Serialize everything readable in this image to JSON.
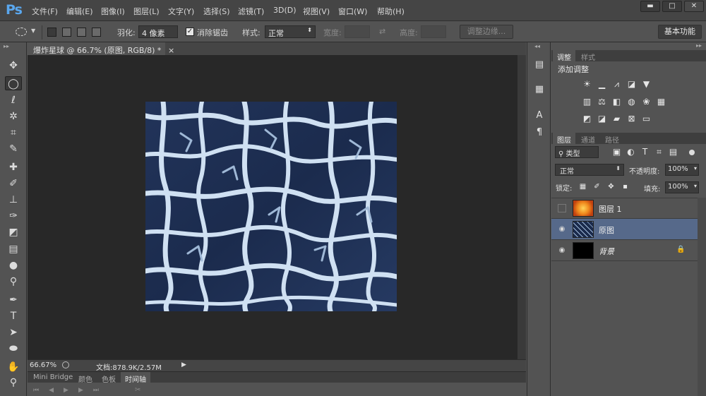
{
  "app": {
    "logo": "Ps"
  },
  "menu": [
    "文件(F)",
    "编辑(E)",
    "图像(I)",
    "图层(L)",
    "文字(Y)",
    "选择(S)",
    "滤镜(T)",
    "3D(D)",
    "视图(V)",
    "窗口(W)",
    "帮助(H)"
  ],
  "window_controls": {
    "minimize": "▬",
    "maximize": "□",
    "close": "✕"
  },
  "options": {
    "feather_label": "羽化:",
    "feather_value": "4 像素",
    "antialias_label": "消除锯齿",
    "style_label": "样式:",
    "style_value": "正常",
    "width_label": "宽度:",
    "height_label": "高度:",
    "refine_edge": "调整边缘...",
    "workspace": "基本功能"
  },
  "document": {
    "tab_title": "爆炸星球 @ 66.7% (原图, RGB/8) *",
    "tab_close": "×",
    "zoom": "66.67%",
    "doc_info": "文档:878.9K/2.57M"
  },
  "bottom_tabs": [
    "Mini Bridge",
    "颜色",
    "色板",
    "时间轴"
  ],
  "adjust_panel": {
    "tabs": [
      "调整",
      "样式"
    ],
    "title": "添加调整"
  },
  "layers_panel": {
    "tabs": [
      "图层",
      "通道",
      "路径"
    ],
    "filter_kind": "类型",
    "blend_mode": "正常",
    "opacity_label": "不透明度:",
    "opacity_value": "100%",
    "lock_label": "锁定:",
    "fill_label": "填充:",
    "fill_value": "100%",
    "layers": [
      {
        "name": "图层 1",
        "visible": false,
        "selected": false
      },
      {
        "name": "原图",
        "visible": true,
        "selected": true
      },
      {
        "name": "背景",
        "visible": true,
        "selected": false,
        "locked": true
      }
    ]
  },
  "colors": {
    "selected_layer": "#56698a",
    "accent": "#5aa7ee",
    "crack_light": "#cfe0f2",
    "crack_dark": "#1b2b4d"
  }
}
